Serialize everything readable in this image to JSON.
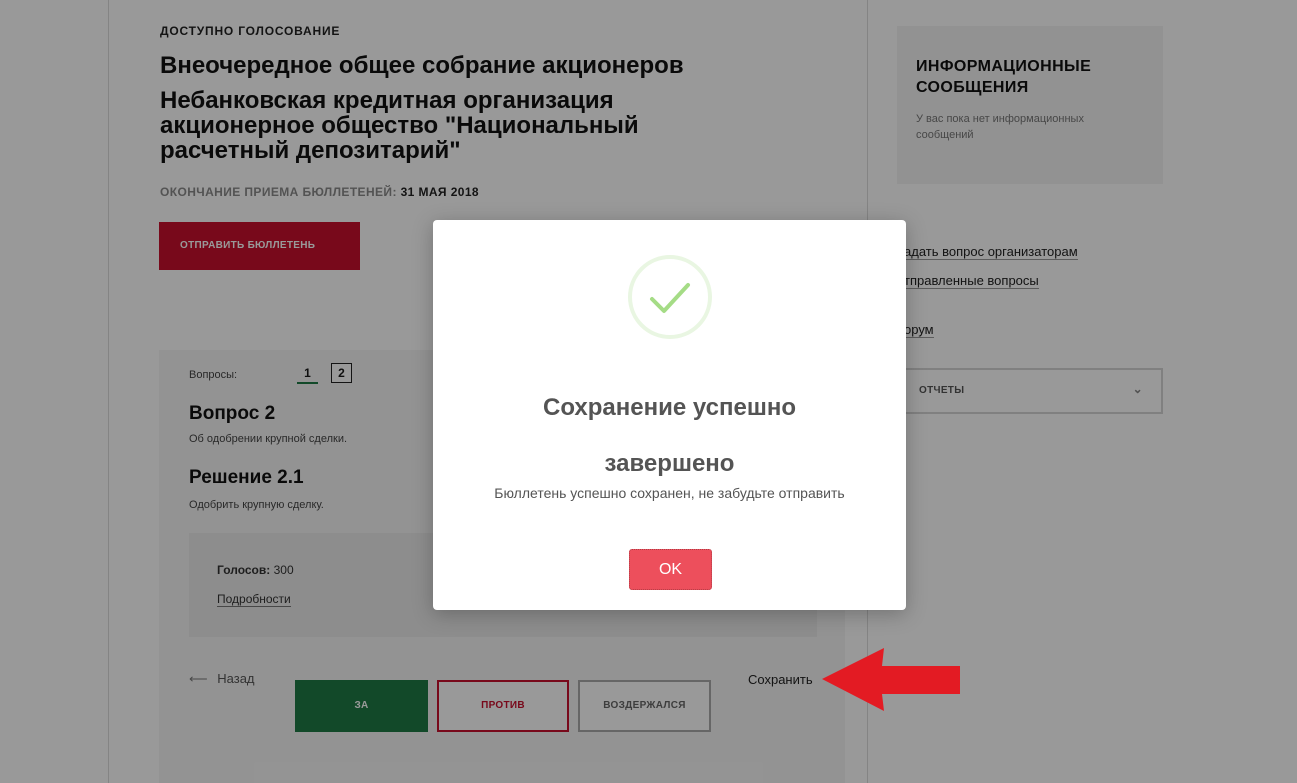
{
  "ballot": {
    "status": "ДОСТУПНО ГОЛОСОВАНИЕ",
    "meeting_title": "Внеочередное общее собрание акционеров",
    "organization": "Небанковская кредитная организация акционерное общество \"Национальный расчетный депозитарий\"",
    "deadline_label": "ОКОНЧАНИЕ ПРИЕМА БЮЛЛЕТЕНЕЙ:",
    "deadline_date": "31 МАЯ 2018",
    "send_button": "ОТПРАВИТЬ БЮЛЛЕТЕНЬ"
  },
  "sidebar": {
    "info_title": "ИНФОРМАЦИОННЫЕ СООБЩЕНИЯ",
    "info_empty": "У вас пока нет информационных сообщений",
    "ask_link": "адать вопрос организаторам",
    "sent_link": "тправленные вопросы",
    "forum_link": "орум",
    "reports_label": "ОТЧЕТЫ",
    "reports_chevron": "⌄"
  },
  "questions": {
    "label": "Вопросы:",
    "numbers": [
      "1",
      "2"
    ],
    "question_title": "Вопрос 2",
    "question_desc": "Об одобрении крупной сделки.",
    "decision_title": "Решение 2.1",
    "decision_desc": "Одобрить крупную сделку.",
    "votes_label": "Голосов:",
    "votes_value": "300",
    "details_link": "Подробности",
    "back_arrow": "⟵",
    "back_link": "Назад",
    "vote_for": "ЗА",
    "vote_against": "ПРОТИВ",
    "vote_abstain": "ВОЗДЕРЖАЛСЯ",
    "save_link": "Сохранить"
  },
  "modal": {
    "title_line1": "Сохранение успешно",
    "title_line2": "завершено",
    "text": "Бюллетень успешно сохранен, не забудьте отправить",
    "ok_button": "OK",
    "icon": "check-icon"
  },
  "colors": {
    "brand_red": "#c8102e",
    "vote_green": "#1e7b45",
    "ok_red": "#ed4f5c",
    "check_green": "#a5dc86",
    "arrow_red": "#e31b23"
  }
}
